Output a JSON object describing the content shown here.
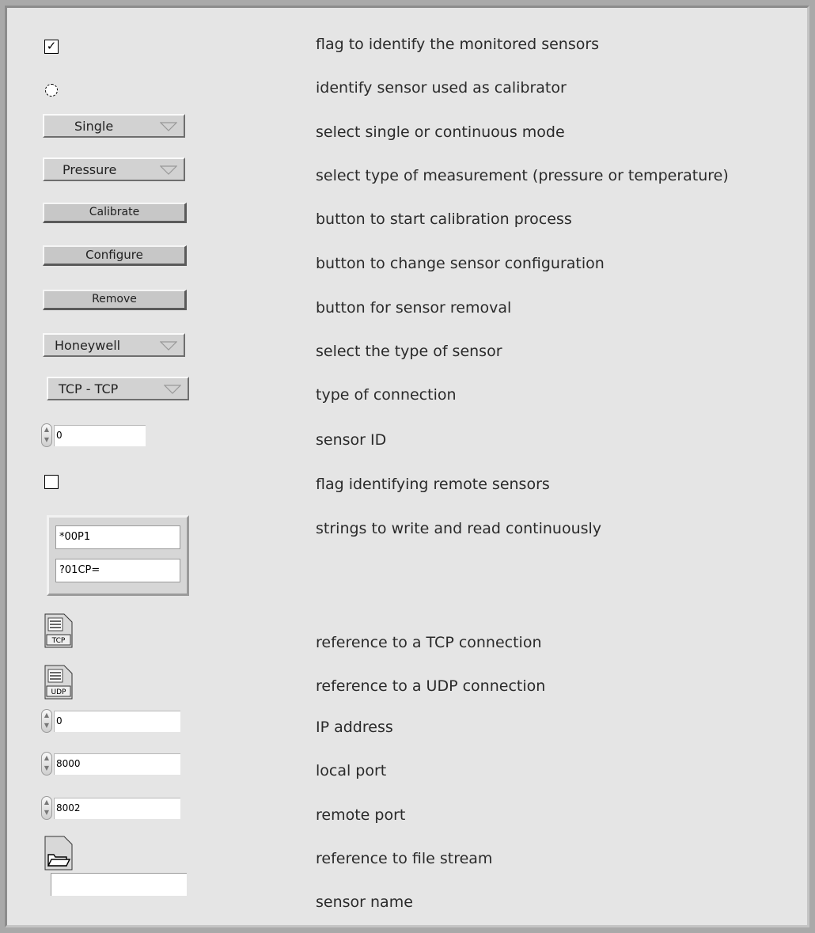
{
  "rows": [
    {
      "desc": "flag to identify the monitored sensors",
      "control": "checkbox",
      "checked": true
    },
    {
      "desc": "identify sensor used as calibrator",
      "control": "radio"
    },
    {
      "desc": "select single or continuous mode",
      "control": "ring",
      "value": "Single"
    },
    {
      "desc": "select type of measurement (pressure or temperature)",
      "control": "ring",
      "value": "Pressure"
    },
    {
      "desc": "button to start calibration process",
      "control": "button",
      "label": "Calibrate"
    },
    {
      "desc": "button to change sensor configuration",
      "control": "button",
      "label": "Configure"
    },
    {
      "desc": "button for sensor removal",
      "control": "button",
      "label": "Remove"
    },
    {
      "desc": "select the type of sensor",
      "control": "ring",
      "value": "Honeywell"
    },
    {
      "desc": "type of connection",
      "control": "ring",
      "value": "TCP - TCP"
    },
    {
      "desc": "sensor ID",
      "control": "numeric",
      "value": "0"
    },
    {
      "desc": "flag identifying remote sensors",
      "control": "checkbox",
      "checked": false
    },
    {
      "desc": "strings to write and read continuously",
      "control": "string-array",
      "values": [
        "*00P1",
        "?01CP="
      ]
    },
    {
      "desc": "reference to a TCP connection",
      "control": "refnum",
      "icon_label": "TCP"
    },
    {
      "desc": "reference to a UDP connection",
      "control": "refnum",
      "icon_label": "UDP"
    },
    {
      "desc": "IP address",
      "control": "numeric",
      "value": "0"
    },
    {
      "desc": "local port",
      "control": "numeric",
      "value": "8000"
    },
    {
      "desc": "remote port",
      "control": "numeric",
      "value": "8002"
    },
    {
      "desc": "reference to file stream",
      "control": "refnum-file",
      "icon": "folder-icon"
    },
    {
      "desc": "sensor name",
      "control": "string",
      "value": ""
    }
  ],
  "checkmark": "✓",
  "ring_arrow_icon": "triangle-down-icon",
  "spin_icon": "up-down-arrows-icon"
}
